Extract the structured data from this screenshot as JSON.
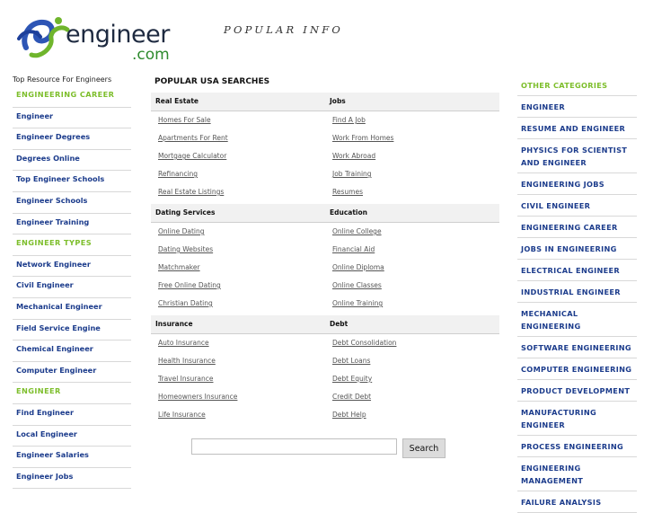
{
  "logo": {
    "text": "engineer",
    "domain": ".com"
  },
  "header": {
    "title": "POPULAR INFO"
  },
  "tagline": "Top Resource For Engineers",
  "left_nav": [
    {
      "type": "heading",
      "label": "ENGINEERING CAREER"
    },
    {
      "type": "link",
      "label": "Engineer"
    },
    {
      "type": "link",
      "label": "Engineer Degrees"
    },
    {
      "type": "link",
      "label": "Degrees Online"
    },
    {
      "type": "link",
      "label": "Top Engineer Schools"
    },
    {
      "type": "link",
      "label": "Engineer Schools"
    },
    {
      "type": "link",
      "label": "Engineer Training"
    },
    {
      "type": "heading",
      "label": "ENGINEER TYPES"
    },
    {
      "type": "link",
      "label": "Network Engineer"
    },
    {
      "type": "link",
      "label": "Civil Engineer"
    },
    {
      "type": "link",
      "label": "Mechanical Engineer"
    },
    {
      "type": "link",
      "label": "Field Service Engine"
    },
    {
      "type": "link",
      "label": "Chemical Engineer"
    },
    {
      "type": "link",
      "label": "Computer Engineer"
    },
    {
      "type": "heading",
      "label": "ENGINEER"
    },
    {
      "type": "link",
      "label": "Find Engineer"
    },
    {
      "type": "link",
      "label": "Local Engineer"
    },
    {
      "type": "link",
      "label": "Engineer Salaries"
    },
    {
      "type": "link",
      "label": "Engineer Jobs"
    }
  ],
  "main": {
    "title": "POPULAR USA SEARCHES",
    "blocks": [
      {
        "left": {
          "title": "Real Estate",
          "links": [
            "Homes For Sale",
            "Apartments For Rent",
            "Mortgage Calculator",
            "Refinancing",
            "Real Estate Listings"
          ]
        },
        "right": {
          "title": "Jobs",
          "links": [
            "Find A Job",
            "Work From Homes",
            "Work Abroad",
            "Job Training",
            "Resumes"
          ]
        }
      },
      {
        "left": {
          "title": "Dating Services",
          "links": [
            "Online Dating",
            "Dating Websites",
            "Matchmaker",
            "Free Online Dating",
            "Christian Dating"
          ]
        },
        "right": {
          "title": "Education",
          "links": [
            "Online College",
            "Financial Aid",
            "Online Diploma",
            "Online Classes",
            "Online Training"
          ]
        }
      },
      {
        "left": {
          "title": "Insurance",
          "links": [
            "Auto Insurance",
            "Health Insurance",
            "Travel Insurance",
            "Homeowners Insurance",
            "Life Insurance"
          ]
        },
        "right": {
          "title": "Debt",
          "links": [
            "Debt Consolidation",
            "Debt Loans",
            "Debt Equity",
            "Credit Debt",
            "Debt Help"
          ]
        }
      }
    ]
  },
  "search": {
    "value": "",
    "button_label": "Search"
  },
  "right_nav": [
    {
      "type": "heading",
      "label": "OTHER CATEGORIES"
    },
    {
      "type": "link",
      "label": "ENGINEER"
    },
    {
      "type": "link",
      "label": "RESUME AND ENGINEER"
    },
    {
      "type": "link",
      "label": "PHYSICS FOR SCIENTIST AND ENGINEER"
    },
    {
      "type": "link",
      "label": "ENGINEERING JOBS"
    },
    {
      "type": "link",
      "label": "CIVIL ENGINEER"
    },
    {
      "type": "link",
      "label": "ENGINEERING CAREER"
    },
    {
      "type": "link",
      "label": "JOBS IN ENGINEERING"
    },
    {
      "type": "link",
      "label": "ELECTRICAL ENGINEER"
    },
    {
      "type": "link",
      "label": "INDUSTRIAL ENGINEER"
    },
    {
      "type": "link",
      "label": "MECHANICAL ENGINEERING"
    },
    {
      "type": "link",
      "label": "SOFTWARE ENGINEERING"
    },
    {
      "type": "link",
      "label": "COMPUTER ENGINEERING"
    },
    {
      "type": "link",
      "label": "PRODUCT DEVELOPMENT"
    },
    {
      "type": "link",
      "label": "MANUFACTURING ENGINEER"
    },
    {
      "type": "link",
      "label": "PROCESS ENGINEERING"
    },
    {
      "type": "link",
      "label": "ENGINEERING MANAGEMENT"
    },
    {
      "type": "link",
      "label": "FAILURE ANALYSIS"
    }
  ],
  "colors": {
    "link": "#1c3c8c",
    "heading": "#7dbe2b",
    "logo_green": "#6fb52c",
    "logo_blue": "#2d55b5"
  }
}
